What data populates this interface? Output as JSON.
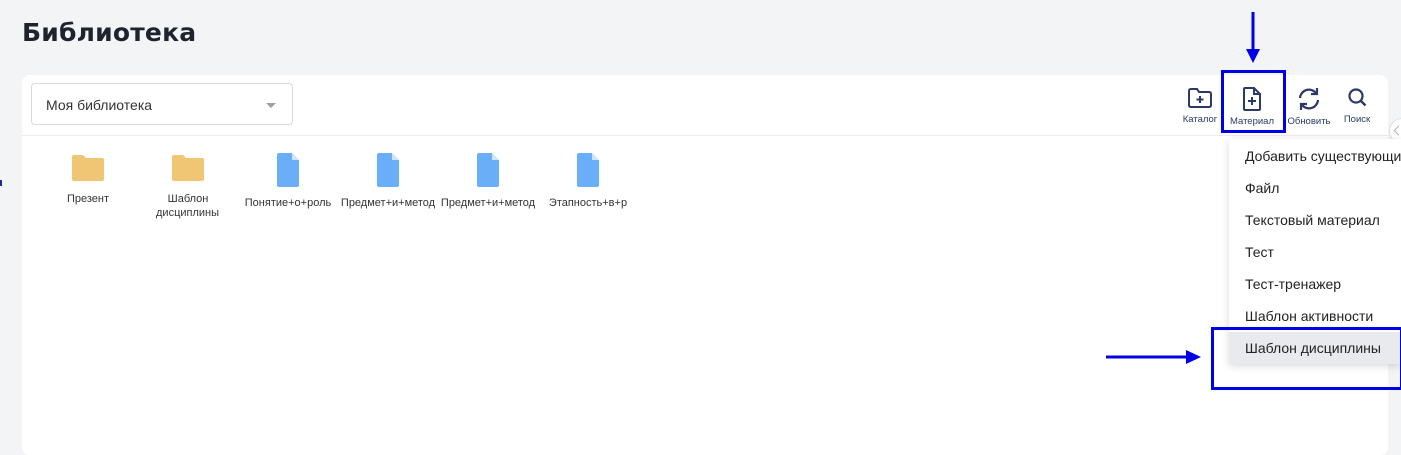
{
  "page": {
    "title": "Библиотека"
  },
  "toolbar": {
    "library_select": {
      "value": "Моя библиотека"
    },
    "buttons": [
      {
        "label": "Каталог",
        "icon": "folder-plus-icon"
      },
      {
        "label": "Материал",
        "icon": "file-plus-icon"
      },
      {
        "label": "Обновить",
        "icon": "refresh-icon"
      },
      {
        "label": "Поиск",
        "icon": "search-icon"
      }
    ]
  },
  "items": [
    {
      "type": "folder",
      "name": "Презент"
    },
    {
      "type": "folder",
      "name": "Шаблон дисциплины..."
    },
    {
      "type": "file",
      "name": "Понятие+о+роль"
    },
    {
      "type": "file",
      "name": "Предмет+и+метод"
    },
    {
      "type": "file",
      "name": "Предмет+и+метод"
    },
    {
      "type": "file",
      "name": "Этапность+в+р"
    }
  ],
  "material_menu": {
    "items": [
      "Добавить существующий",
      "Файл",
      "Текстовый материал",
      "Тест",
      "Тест-тренажер",
      "Шаблон активности",
      "Шаблон дисциплины"
    ],
    "highlighted_index": 6
  },
  "colors": {
    "folder": "#f0c674",
    "file": "#6aaef7",
    "icon_navy": "#2b3a67",
    "annotation": "#0000e6"
  }
}
